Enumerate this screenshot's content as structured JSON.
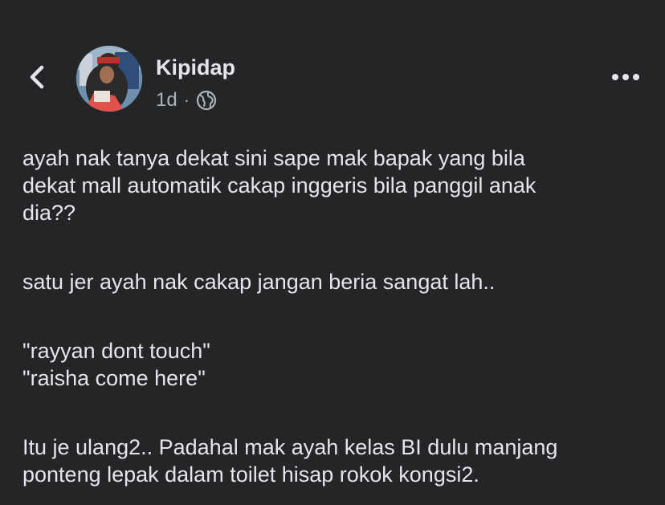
{
  "header": {
    "back_icon": "chevron-left-icon",
    "author_name": "Kipidap",
    "timestamp": "1d",
    "separator": "·",
    "privacy_icon": "globe-icon",
    "more_icon": "more-horizontal-icon"
  },
  "post": {
    "paragraphs": [
      [
        "ayah nak tanya dekat sini sape mak bapak yang bila",
        "dekat mall automatik cakap inggeris bila panggil anak",
        "dia??"
      ],
      [
        "satu jer ayah nak cakap jangan beria sangat lah.."
      ],
      [
        "\"rayyan dont touch\"",
        "\"raisha come here\""
      ],
      [
        "Itu je ulang2.. Padahal mak ayah kelas BI dulu manjang",
        "ponteng lepak dalam toilet hisap rokok kongsi2."
      ]
    ]
  },
  "colors": {
    "background": "#242527",
    "primary_text": "#e4e6eb",
    "secondary_text": "#b0b3b8"
  }
}
